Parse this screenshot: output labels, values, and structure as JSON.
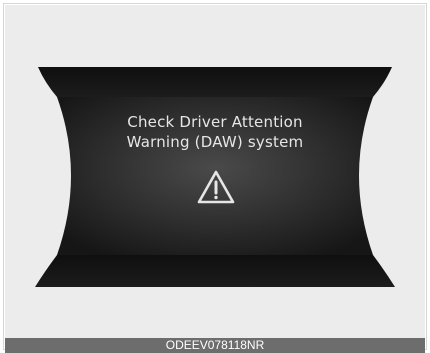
{
  "display": {
    "message_line1": "Check Driver Attention",
    "message_line2": "Warning (DAW) system",
    "icon": "warning-triangle-icon"
  },
  "caption": {
    "code": "ODEEV078118NR"
  },
  "colors": {
    "panel_background": "#ececec",
    "display_dark": "#1a1a1a",
    "display_mid": "#3a3a3a",
    "text": "#e6e6e6",
    "caption_bar": "#6d6d6d"
  }
}
